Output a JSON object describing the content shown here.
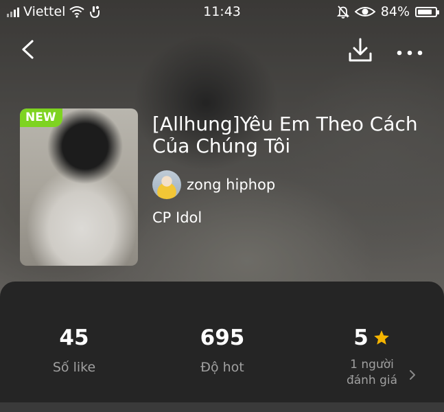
{
  "status_bar": {
    "carrier": "Viettel",
    "time": "11:43",
    "battery_percent": "84%",
    "battery_level": 0.84,
    "icons": [
      "signal-icon",
      "wifi-icon",
      "notification-icon",
      "bell-muted-icon",
      "eye-icon",
      "battery-icon"
    ]
  },
  "toolbar": {
    "icons": [
      "back-icon",
      "download-icon",
      "more-icon"
    ]
  },
  "story": {
    "badge": "NEW",
    "title": "[Allhung]Yêu Em Theo Cách Của Chúng Tôi",
    "author": "zong hiphop",
    "category": "CP Idol"
  },
  "stats": {
    "likes_value": "45",
    "likes_label": "Số like",
    "hot_value": "695",
    "hot_label": "Độ hot",
    "rating_value": "5",
    "rating_label_line1": "1 người",
    "rating_label_line2": "đánh giá"
  },
  "colors": {
    "accent_new": "#7ed321",
    "star": "#f5b400",
    "panel": "#252525"
  }
}
